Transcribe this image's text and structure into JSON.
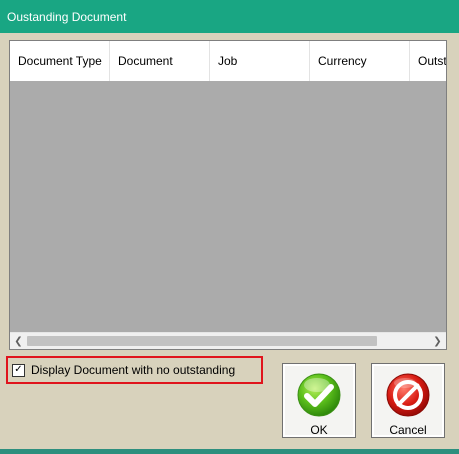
{
  "window": {
    "title": "Oustanding Document"
  },
  "grid": {
    "columns": [
      "Document Type",
      "Document",
      "Job",
      "Currency",
      "Outst"
    ]
  },
  "options": {
    "display_no_outstanding_label": "Display Document with no outstanding",
    "display_no_outstanding_checked": "✓"
  },
  "buttons": {
    "ok_label": "OK",
    "cancel_label": "Cancel"
  },
  "colors": {
    "titlebar": "#19a683",
    "dialog_bg": "#d8d2bc",
    "grid_body": "#ababab",
    "highlight_border": "#e0141c"
  }
}
